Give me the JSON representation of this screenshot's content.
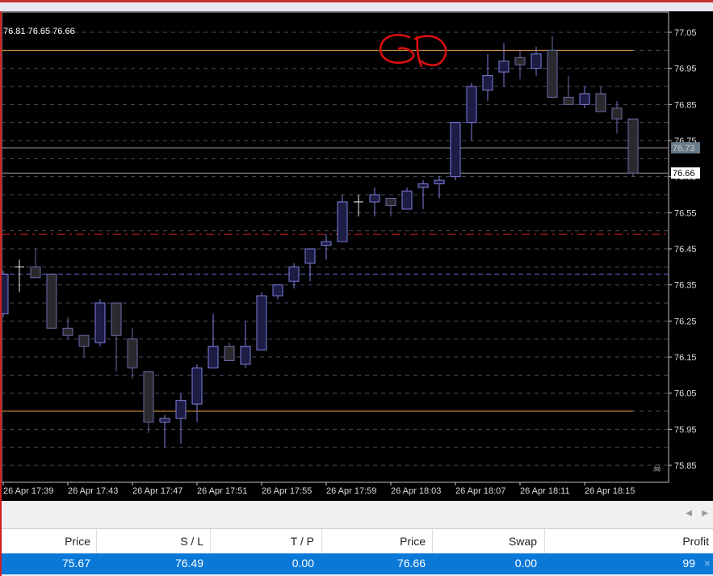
{
  "chart_header": {
    "ohlc_text": "76.81 76.65 76.66"
  },
  "chart_data": {
    "type": "candlestick",
    "price_axis": {
      "ticks": [
        "77.05",
        "76.95",
        "76.85",
        "76.75",
        "76.65",
        "76.55",
        "76.45",
        "76.35",
        "76.25",
        "76.15",
        "76.05",
        "75.95",
        "75.85"
      ],
      "range": [
        75.81,
        77.08
      ]
    },
    "time_axis": {
      "ticks": [
        "26 Apr 17:39",
        "26 Apr 17:43",
        "26 Apr 17:47",
        "26 Apr 17:51",
        "26 Apr 17:55",
        "26 Apr 17:59",
        "26 Apr 18:03",
        "26 Apr 18:07",
        "26 Apr 18:11",
        "26 Apr 18:15"
      ]
    },
    "candles": [
      [
        76.27,
        76.39,
        76.26,
        76.38
      ],
      [
        76.4,
        76.42,
        76.33,
        76.4
      ],
      [
        76.4,
        76.45,
        76.37,
        76.37
      ],
      [
        76.38,
        76.38,
        76.23,
        76.23
      ],
      [
        76.23,
        76.26,
        76.2,
        76.21
      ],
      [
        76.21,
        76.21,
        76.15,
        76.18
      ],
      [
        76.19,
        76.31,
        76.18,
        76.3
      ],
      [
        76.3,
        76.3,
        76.11,
        76.21
      ],
      [
        76.2,
        76.23,
        76.09,
        76.12
      ],
      [
        76.11,
        76.11,
        75.94,
        75.97
      ],
      [
        75.97,
        75.99,
        75.9,
        75.98
      ],
      [
        75.98,
        76.05,
        75.91,
        76.03
      ],
      [
        76.02,
        76.13,
        75.97,
        76.12
      ],
      [
        76.12,
        76.27,
        76.12,
        76.18
      ],
      [
        76.18,
        76.19,
        76.14,
        76.14
      ],
      [
        76.13,
        76.25,
        76.12,
        76.18
      ],
      [
        76.17,
        76.33,
        76.17,
        76.32
      ],
      [
        76.32,
        76.35,
        76.31,
        76.35
      ],
      [
        76.36,
        76.41,
        76.34,
        76.4
      ],
      [
        76.41,
        76.45,
        76.36,
        76.45
      ],
      [
        76.46,
        76.49,
        76.42,
        76.47
      ],
      [
        76.47,
        76.6,
        76.47,
        76.58
      ],
      [
        76.58,
        76.6,
        76.54,
        76.58
      ],
      [
        76.58,
        76.62,
        76.54,
        76.6
      ],
      [
        76.59,
        76.59,
        76.54,
        76.57
      ],
      [
        76.56,
        76.62,
        76.56,
        76.61
      ],
      [
        76.62,
        76.64,
        76.56,
        76.63
      ],
      [
        76.63,
        76.65,
        76.59,
        76.64
      ],
      [
        76.65,
        76.8,
        76.64,
        76.8
      ],
      [
        76.8,
        76.91,
        76.75,
        76.9
      ],
      [
        76.89,
        76.99,
        76.86,
        76.93
      ],
      [
        76.94,
        77.02,
        76.9,
        76.97
      ],
      [
        76.98,
        77.0,
        76.92,
        76.96
      ],
      [
        76.95,
        77.01,
        76.93,
        76.99
      ],
      [
        77.0,
        77.04,
        76.87,
        76.87
      ],
      [
        76.87,
        76.93,
        76.85,
        76.85
      ],
      [
        76.85,
        76.9,
        76.84,
        76.88
      ],
      [
        76.88,
        76.9,
        76.83,
        76.83
      ],
      [
        76.84,
        76.86,
        76.77,
        76.81
      ],
      [
        76.81,
        76.81,
        76.65,
        76.66
      ]
    ],
    "levels": {
      "resistance": 77.0,
      "support": 76.0,
      "ask": "76.73",
      "bid": "76.66",
      "stop_loss": 76.49,
      "marker": 76.38
    },
    "colors": {
      "bull": "#8080e0",
      "bear": "#6a6aa8",
      "support_resistance": "#e0a040",
      "stop_loss": "#e02020",
      "annotation": "#e01010"
    },
    "annotation": "SD"
  },
  "trade_table": {
    "headers": [
      "Price",
      "S / L",
      "T / P",
      "Price",
      "Swap",
      "Profit"
    ],
    "row": [
      "75.67",
      "76.49",
      "0.00",
      "76.66",
      "0.00",
      "99"
    ],
    "close_icon": "×"
  }
}
